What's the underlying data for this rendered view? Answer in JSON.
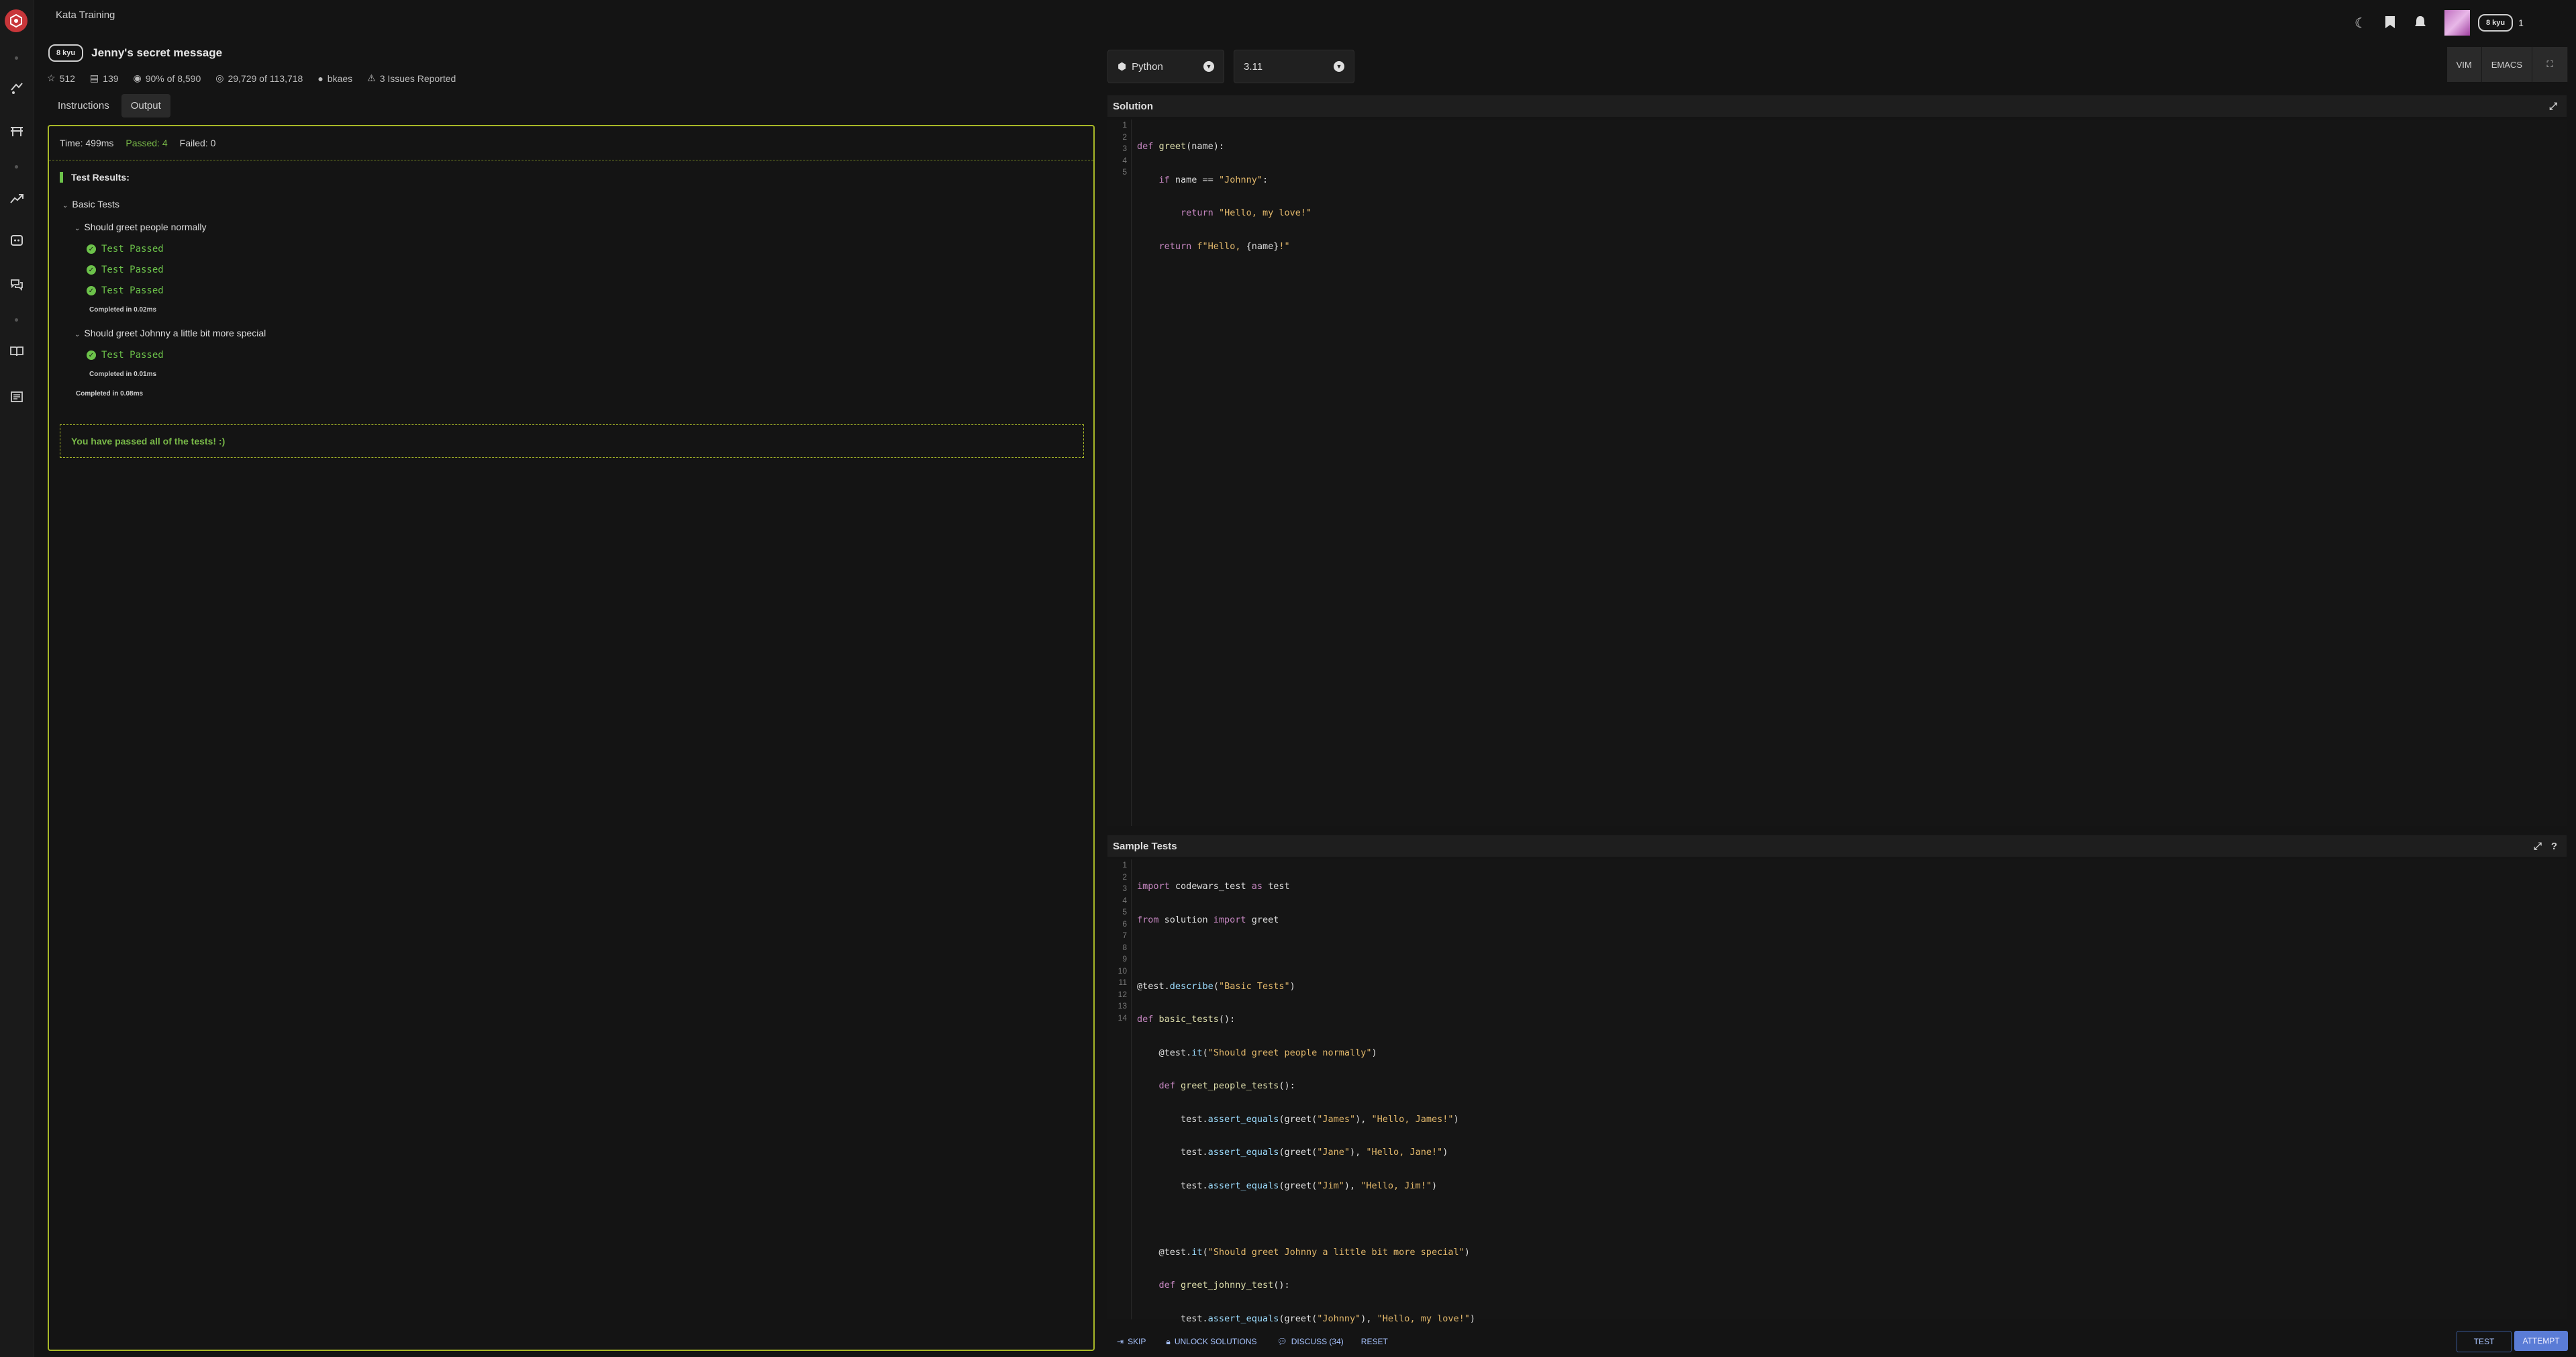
{
  "header": {
    "breadcrumb": "Kata Training",
    "rank": "8 kyu",
    "kata_title": "Jenny's secret message",
    "stats": {
      "stars": "512",
      "collections": "139",
      "satisfaction": "90% of 8,590",
      "completions": "29,729 of 113,718",
      "author": "bkaes",
      "issues": "3 Issues Reported"
    },
    "user_rank": "8 kyu",
    "user_honor": "1"
  },
  "tabs": [
    "Instructions",
    "Output"
  ],
  "output": {
    "time": "Time: 499ms",
    "passed": "Passed: 4",
    "failed": "Failed: 0",
    "results_title": "Test Results:",
    "group": "Basic Tests",
    "it1": "Should greet people normally",
    "it1_passes": [
      "Test Passed",
      "Test Passed",
      "Test Passed"
    ],
    "it1_time": "Completed in 0.02ms",
    "it2": "Should greet Johnny a little bit more special",
    "it2_passes": [
      "Test Passed"
    ],
    "it2_time": "Completed in 0.01ms",
    "group_time": "Completed in 0.08ms",
    "success": "You have passed all of the tests! :)"
  },
  "language": {
    "name": "Python",
    "version": "3.11"
  },
  "modes": [
    "VIM",
    "EMACS"
  ],
  "solution": {
    "title": "Solution",
    "lines": [
      "def greet(name):",
      "    if name == \"Johnny\":",
      "        return \"Hello, my love!\"",
      "    return f\"Hello, {name}!\"",
      ""
    ]
  },
  "sample_tests": {
    "title": "Sample Tests",
    "lines": [
      "import codewars_test as test",
      "from solution import greet",
      "",
      "@test.describe(\"Basic Tests\")",
      "def basic_tests():",
      "    @test.it(\"Should greet people normally\")",
      "    def greet_people_tests():",
      "        test.assert_equals(greet(\"James\"), \"Hello, James!\")",
      "        test.assert_equals(greet(\"Jane\"), \"Hello, Jane!\")",
      "        test.assert_equals(greet(\"Jim\"), \"Hello, Jim!\")",
      "",
      "    @test.it(\"Should greet Johnny a little bit more special\")",
      "    def greet_johnny_test():",
      "        test.assert_equals(greet(\"Johnny\"), \"Hello, my love!\")"
    ]
  },
  "footer": {
    "skip": "SKIP",
    "unlock": "UNLOCK SOLUTIONS",
    "discuss": "DISCUSS (34)",
    "reset": "RESET",
    "test": "TEST",
    "attempt": "ATTEMPT"
  },
  "colors": {
    "accent_border": "#a8b828",
    "pass": "#6cc24a",
    "attempt": "#5a7cd6",
    "logo": "#c8363a"
  }
}
